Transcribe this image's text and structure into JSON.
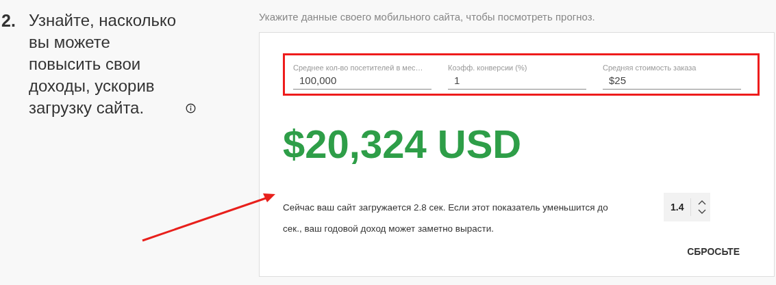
{
  "step": {
    "number": "2.",
    "heading": "Узнайте, насколько вы можете повысить свои доходы, ускорив загрузку сайта."
  },
  "intro": "Укажите данные своего мобильного сайта, чтобы посмотреть прогноз.",
  "fields": [
    {
      "label": "Среднее кол-во посетителей в мес…",
      "value": "100,000"
    },
    {
      "label": "Коэфф. конверсии (%)",
      "value": "1"
    },
    {
      "label": "Средняя стоимость заказа",
      "value": "$25"
    }
  ],
  "amount": "$20,324 USD",
  "sentence_start": "Сейчас ваш сайт загружается 2.8 сек. Если этот показатель уменьшится до",
  "stepper": {
    "value": "1.4"
  },
  "sentence_end": "сек., ваш годовой доход может заметно вырасти.",
  "reset_button": "СБРОСЬТЕ"
}
